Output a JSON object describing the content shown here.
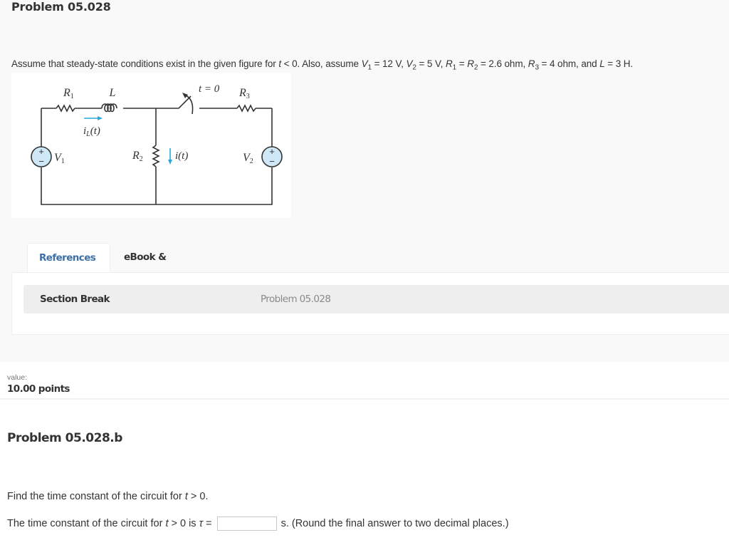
{
  "problem": {
    "title": "Problem 05.028",
    "statement": {
      "prefix": "Assume that steady-state conditions exist in the given figure for ",
      "t_var": "t",
      "cond": " < 0. Also, assume ",
      "V1_sym": "V",
      "V1_sub": "1",
      "V1_val": " = 12 V, ",
      "V2_sym": "V",
      "V2_sub": "2",
      "V2_val": " = 5 V, ",
      "R1_sym": "R",
      "R1_sub": "1",
      "eq1": " = ",
      "R2_sym": "R",
      "R2_sub": "2",
      "R12_val": " = 2.6 ohm, ",
      "R3_sym": "R",
      "R3_sub": "3",
      "R3_val": " = 4 ohm, and ",
      "L_sym": "L",
      "L_val": " = 3 H."
    },
    "figure": {
      "labels": {
        "R1": "R",
        "R1_sub": "1",
        "L": "L",
        "switch": "t = 0",
        "R3": "R",
        "R3_sub": "3",
        "iL": "i",
        "iL_sub": "L",
        "iL_arg": "(t)",
        "V1": "V",
        "V1_sub": "1",
        "R2": "R",
        "R2_sub": "2",
        "i": "i(t)",
        "V2": "V",
        "V2_sub": "2",
        "plus": "+",
        "minus": "−"
      },
      "colors": {
        "wire": "#333333",
        "source_fill": "#cfe8f7",
        "arrow": "#29a8e0",
        "label_accent": "#c87a1e"
      }
    }
  },
  "tabs": [
    {
      "label": "References",
      "active": true
    },
    {
      "label": "eBook & Resources",
      "active": false
    }
  ],
  "reference_panel": {
    "section_break_label": "Section Break",
    "link_text": "Problem 05.028"
  },
  "value": {
    "label": "value:",
    "points": "10.00 points"
  },
  "subproblem": {
    "title": "Problem 05.028.b",
    "question": {
      "prefix": "Find the time constant of the circuit for ",
      "t_var": "t",
      "suffix": " > 0."
    },
    "answer": {
      "prefix": "The time constant of the circuit for ",
      "t_var": "t",
      "mid": " > 0 is ",
      "tau": "τ",
      "eq": " = ",
      "input_value": "",
      "suffix": "s. (Round the final answer to two decimal places.)"
    }
  },
  "colors": {
    "accent": "#3d6ea6",
    "top_bg": "#f9f9f9",
    "section_break_bg": "#eeeeee",
    "muted_text": "#8a8a8a"
  }
}
